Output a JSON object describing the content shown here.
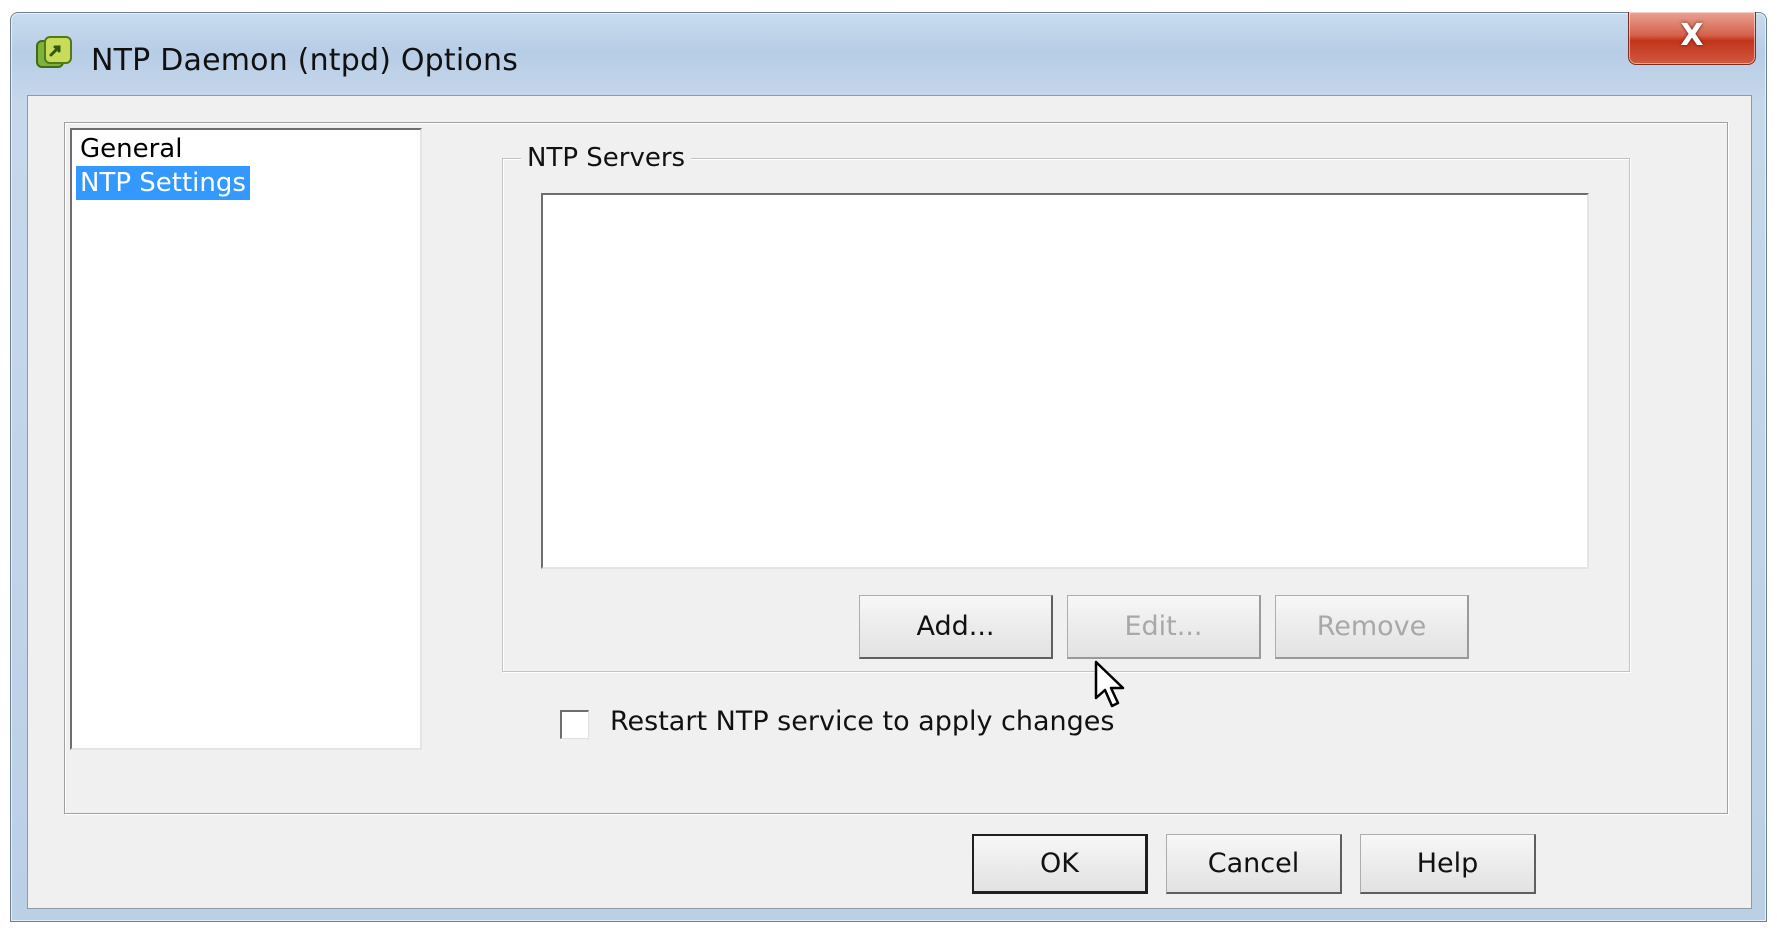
{
  "window": {
    "title": "NTP Daemon (ntpd) Options",
    "close_label": "X"
  },
  "nav": {
    "items": [
      {
        "label": "General",
        "selected": false
      },
      {
        "label": "NTP Settings",
        "selected": true
      }
    ]
  },
  "ntp_servers": {
    "group_label": "NTP Servers",
    "servers": [],
    "buttons": {
      "add": "Add...",
      "edit": "Edit...",
      "remove": "Remove"
    }
  },
  "restart_option": {
    "label": "Restart NTP service to apply changes",
    "checked": false
  },
  "footer": {
    "ok": "OK",
    "cancel": "Cancel",
    "help": "Help"
  },
  "colors": {
    "selection": "#3399ff",
    "close_button": "#c2341b"
  }
}
